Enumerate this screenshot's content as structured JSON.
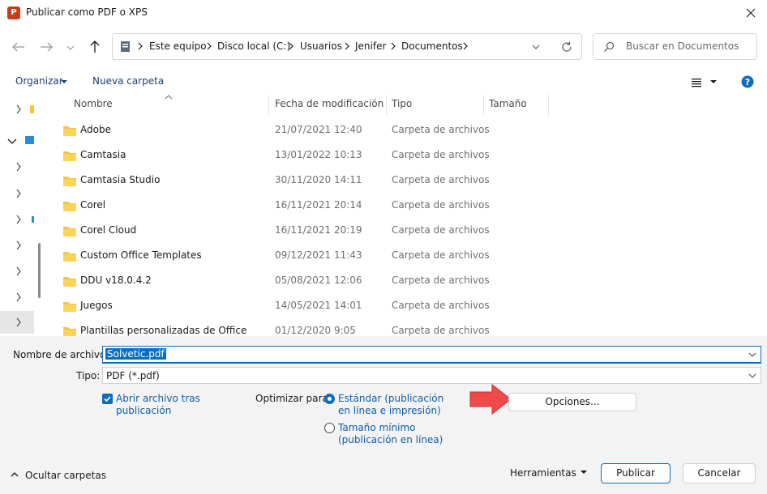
{
  "window": {
    "title": "Publicar como PDF o XPS",
    "app_icon_letter": "P"
  },
  "address_bar": {
    "crumbs": [
      "Este equipo",
      "Disco local (C:)",
      "Usuarios",
      "Jenifer",
      "Documentos"
    ]
  },
  "search": {
    "placeholder": "Buscar en Documentos"
  },
  "commands": {
    "organize": "Organizar",
    "new_folder": "Nueva carpeta"
  },
  "columns": {
    "name": "Nombre",
    "modified": "Fecha de modificación",
    "type": "Tipo",
    "size": "Tamaño"
  },
  "files": [
    {
      "name": "Adobe",
      "modified": "21/07/2021 12:40",
      "type": "Carpeta de archivos"
    },
    {
      "name": "Camtasia",
      "modified": "13/01/2022 10:13",
      "type": "Carpeta de archivos"
    },
    {
      "name": "Camtasia Studio",
      "modified": "30/11/2020 14:11",
      "type": "Carpeta de archivos"
    },
    {
      "name": "Corel",
      "modified": "16/11/2021 20:14",
      "type": "Carpeta de archivos"
    },
    {
      "name": "Corel Cloud",
      "modified": "16/11/2021 20:19",
      "type": "Carpeta de archivos"
    },
    {
      "name": "Custom Office Templates",
      "modified": "09/12/2021 11:43",
      "type": "Carpeta de archivos"
    },
    {
      "name": "DDU v18.0.4.2",
      "modified": "05/08/2021 12:06",
      "type": "Carpeta de archivos"
    },
    {
      "name": "Juegos",
      "modified": "14/05/2021 14:01",
      "type": "Carpeta de archivos"
    },
    {
      "name": "Plantillas personalizadas de Office",
      "modified": "01/12/2020 9:05",
      "type": "Carpeta de archivos"
    }
  ],
  "form": {
    "filename_label": "Nombre de archivo:",
    "filename_value": "Solvetic.pdf",
    "type_label": "Tipo:",
    "type_value": "PDF (*.pdf)",
    "open_after_line1": "Abrir archivo tras",
    "open_after_line2": "publicación",
    "open_after_checked": true,
    "optimize_label": "Optimizar para:",
    "opt_standard_line1": "Estándar (publicación",
    "opt_standard_line2": "en línea e impresión)",
    "opt_min_line1": "Tamaño mínimo",
    "opt_min_line2": "(publicación en línea)",
    "options_button": "Opciones..."
  },
  "footer": {
    "hide_folders": "Ocultar carpetas",
    "tools": "Herramientas",
    "publish": "Publicar",
    "cancel": "Cancelar"
  },
  "colors": {
    "accent": "#0f6cbd",
    "arrow": "#ef4a4a",
    "folder": "#f6c33c"
  }
}
